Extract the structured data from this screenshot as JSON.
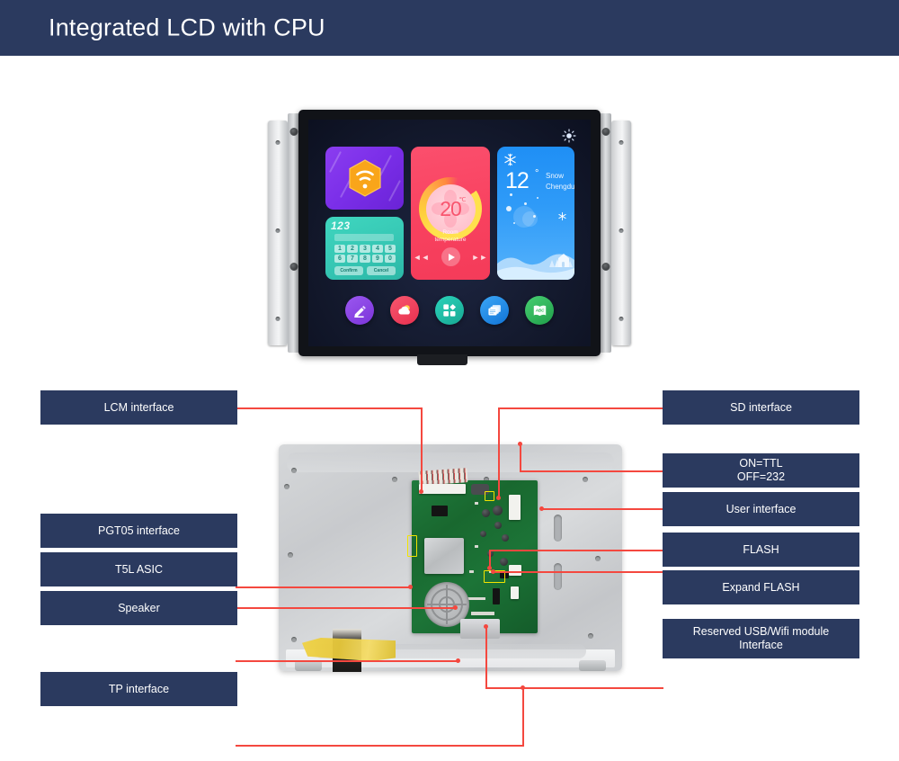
{
  "header": {
    "title": "Integrated LCD with CPU",
    "bg": "#2b3a5f"
  },
  "theme": {
    "navy": "#2b3a5f",
    "leader_red": "#f4483f",
    "highlight_yellow": "#f2e400",
    "page_bg": "#ffffff"
  },
  "lcd_demo": {
    "sun_icon": "sun-icon",
    "tiles": {
      "wifi": {
        "icon": "wifi-hex-icon"
      },
      "keypad": {
        "title": "123",
        "keys": [
          "1",
          "2",
          "3",
          "4",
          "5",
          "6",
          "7",
          "8",
          "9",
          "0"
        ],
        "confirm_label": "Confirm",
        "cancel_label": "Cancel"
      },
      "thermostat": {
        "value": "20",
        "unit": "℃",
        "label_line1": "Room",
        "label_line2": "temperature",
        "prev_icon": "rewind-icon",
        "play_icon": "play-icon",
        "next_icon": "fast-forward-icon"
      },
      "weather": {
        "temperature": "12",
        "degree": "°",
        "condition": "Snow",
        "city": "Chengdu",
        "icon": "snowflake-icon"
      }
    },
    "dock": [
      {
        "name": "dock-icon-notes",
        "icon": "pencil-note-icon",
        "color": "#8b43e8"
      },
      {
        "name": "dock-icon-weather",
        "icon": "cloud-sun-icon",
        "color": "#f0415c"
      },
      {
        "name": "dock-icon-apps",
        "icon": "grid-apps-icon",
        "color": "#1fb9a4"
      },
      {
        "name": "dock-icon-windows",
        "icon": "windows-icon",
        "color": "#1f93ef"
      },
      {
        "name": "dock-icon-abc",
        "icon": "abc-book-icon",
        "color": "#2cb858",
        "label": "ABC"
      }
    ]
  },
  "callouts": {
    "left": [
      {
        "id": "lcm-interface",
        "label": "LCM interface"
      },
      {
        "id": "pgt05-interface",
        "label": "PGT05 interface"
      },
      {
        "id": "t5l-asic",
        "label": "T5L ASIC"
      },
      {
        "id": "speaker",
        "label": "Speaker"
      },
      {
        "id": "tp-interface",
        "label": "TP interface"
      }
    ],
    "right": [
      {
        "id": "sd-interface",
        "label": "SD  interface"
      },
      {
        "id": "ttl-232-switch",
        "label": "ON=TTL\nOFF=232"
      },
      {
        "id": "user-interface",
        "label": "User interface"
      },
      {
        "id": "flash",
        "label": "FLASH"
      },
      {
        "id": "expand-flash",
        "label": "Expand FLASH"
      },
      {
        "id": "usb-wifi",
        "label": "Reserved USB/Wifi module\nInterface"
      }
    ]
  }
}
